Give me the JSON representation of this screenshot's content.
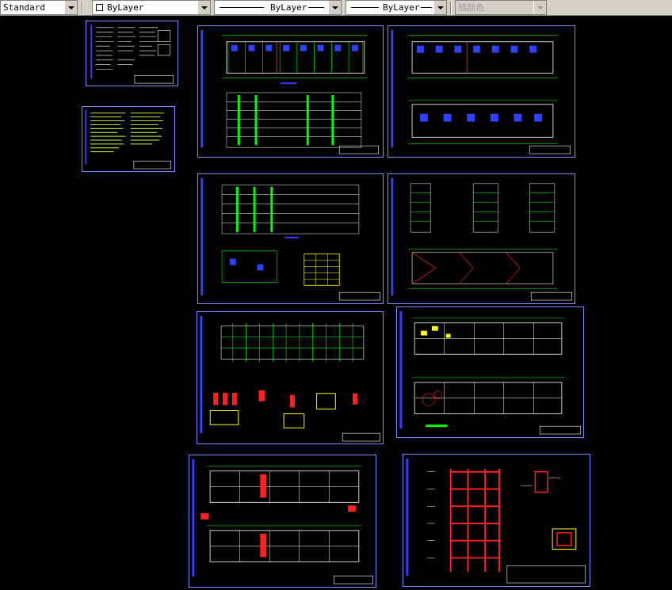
{
  "toolbar": {
    "text_style": "Standard",
    "layer_color": "ByLayer",
    "linetype": "ByLayer",
    "lineweight": "ByLayer",
    "plot_style": "随颜色"
  },
  "colors": {
    "background": "#000000",
    "sheet_border": "#7c8cff",
    "grid": "#00ff00",
    "text_yellow": "#ffff00",
    "structure_red": "#ff2020",
    "plan_blue": "#3040ff",
    "white": "#ffffff",
    "magenta": "#ff00ff"
  }
}
